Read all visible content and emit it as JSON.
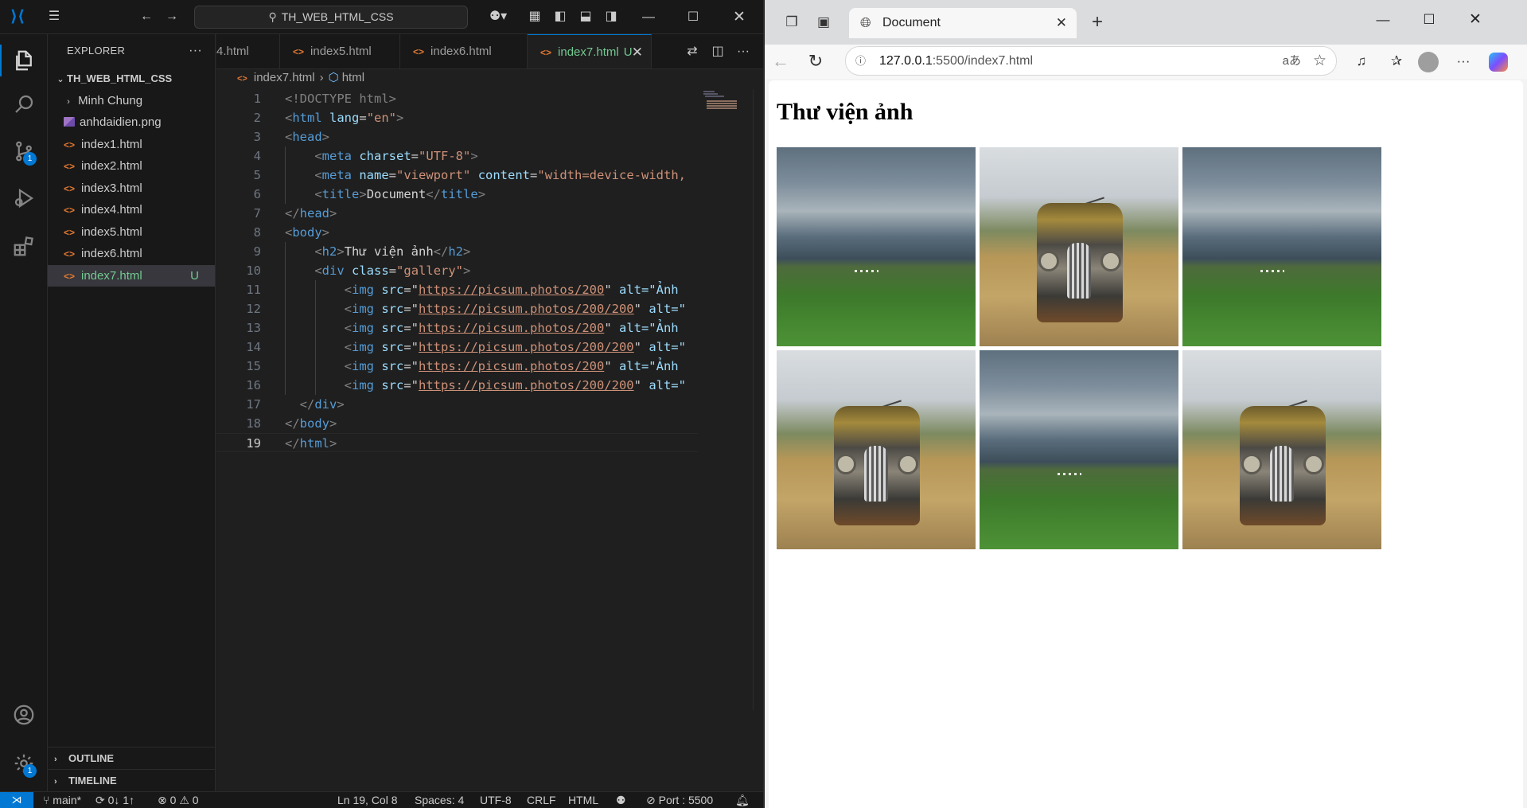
{
  "vscode": {
    "title_search": "TH_WEB_HTML_CSS",
    "explorer": {
      "header": "EXPLORER",
      "root": "TH_WEB_HTML_CSS",
      "folder": "Minh Chung",
      "files": [
        "anhdaidien.png",
        "index1.html",
        "index2.html",
        "index3.html",
        "index4.html",
        "index5.html",
        "index6.html",
        "index7.html"
      ],
      "selected_status": "U",
      "sections": [
        "OUTLINE",
        "TIMELINE"
      ]
    },
    "activity_badges": {
      "scm": "1",
      "manage": "1"
    },
    "tabs": [
      {
        "label": "4.html"
      },
      {
        "label": "index5.html"
      },
      {
        "label": "index6.html"
      },
      {
        "label": "index7.html",
        "status": "U",
        "active": true
      }
    ],
    "breadcrumb": {
      "file": "index7.html",
      "symbol": "html"
    },
    "code_lines": [
      {
        "n": "1"
      },
      {
        "n": "2"
      },
      {
        "n": "3"
      },
      {
        "n": "4"
      },
      {
        "n": "5"
      },
      {
        "n": "6"
      },
      {
        "n": "7"
      },
      {
        "n": "8"
      },
      {
        "n": "9"
      },
      {
        "n": "10"
      },
      {
        "n": "11"
      },
      {
        "n": "12"
      },
      {
        "n": "13"
      },
      {
        "n": "14"
      },
      {
        "n": "15"
      },
      {
        "n": "16"
      },
      {
        "n": "17"
      },
      {
        "n": "18"
      },
      {
        "n": "19"
      }
    ],
    "code": {
      "doctype": "<!DOCTYPE html>",
      "lang_value": "\"en\"",
      "charset_value": "\"UTF-8\"",
      "viewport_value": "\"viewport\"",
      "content_value": "\"width=device-width,",
      "title_text": "Document",
      "h2_text": "Thư viện ảnh",
      "gallery_class": "\"gallery\"",
      "img_srcs": [
        "https://picsum.photos/200",
        "https://picsum.photos/200/200",
        "https://picsum.photos/200",
        "https://picsum.photos/200/200",
        "https://picsum.photos/200",
        "https://picsum.photos/200/200"
      ],
      "alt_tail_short": "alt=\"Ảnh",
      "alt_tail_long": "alt=\""
    },
    "status": {
      "branch": "main*",
      "sync": "0↓ 1↑",
      "problems": "0",
      "warnings": "0",
      "cursor": "Ln 19, Col 8",
      "spaces": "Spaces: 4",
      "encoding": "UTF-8",
      "eol": "CRLF",
      "language": "HTML",
      "port": "Port : 5500"
    }
  },
  "edge": {
    "tab_title": "Document",
    "url_host": "127.0.0.1",
    "url_rest": ":5500/index7.html",
    "page": {
      "heading": "Thư viện ảnh",
      "images": [
        {
          "subject": "storm-over-field"
        },
        {
          "subject": "old-truck"
        },
        {
          "subject": "storm-over-field"
        },
        {
          "subject": "old-truck"
        },
        {
          "subject": "storm-over-field"
        },
        {
          "subject": "old-truck"
        }
      ]
    }
  },
  "colors": {
    "accent": "#0078d4",
    "untracked": "#73c991",
    "html_icon": "#e37933"
  }
}
